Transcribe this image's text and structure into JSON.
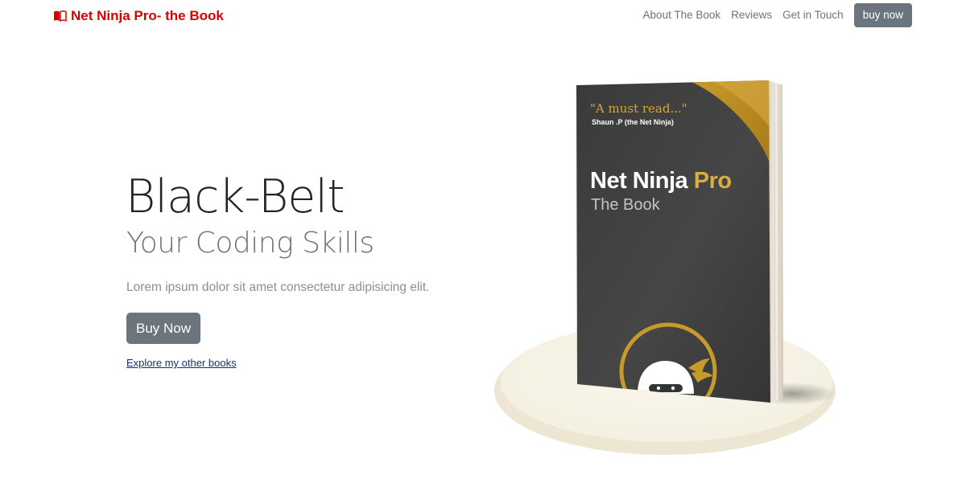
{
  "navbar": {
    "brand_icon": "book-icon",
    "brand_label": "Net Ninja Pro- the Book",
    "links": [
      {
        "label": "About The Book"
      },
      {
        "label": "Reviews"
      },
      {
        "label": "Get in Touch"
      }
    ],
    "buy_label": "buy now"
  },
  "hero": {
    "title": "Black-Belt",
    "subtitle": "Your Coding Skills",
    "lead": "Lorem ipsum dolor sit amet consectetur adipisicing elit.",
    "button_label": "Buy Now",
    "link_label": "Explore my other books"
  },
  "book": {
    "quote": "\"A must read...\"",
    "author": "Shaun .P (the Net Ninja)",
    "title_main": "Net Ninja",
    "title_accent": "Pro",
    "subtitle": "The Book"
  },
  "colors": {
    "brand": "#dc0000",
    "button": "#6c757d",
    "book_gold": "#d8ad44",
    "book_cover": "#3b3b3b"
  }
}
